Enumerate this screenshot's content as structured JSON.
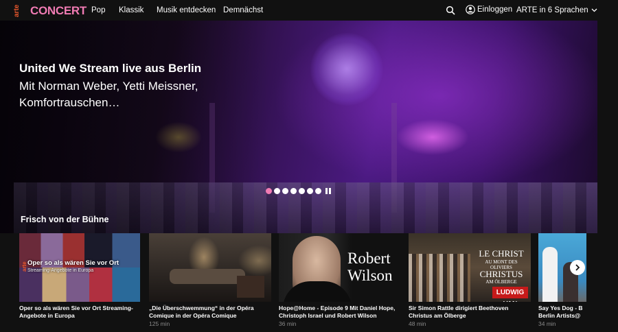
{
  "header": {
    "arte_logo_text": "arte",
    "brand": "CONCERT",
    "nav": [
      "Pop",
      "Klassik",
      "Musik entdecken",
      "Demnächst"
    ],
    "login_label": "Einloggen",
    "language_label": "ARTE in 6 Sprachen",
    "icons": [
      "search-icon",
      "user-icon",
      "chevron-down-icon"
    ]
  },
  "hero": {
    "title": "United We Stream live aus Berlin",
    "subtitle": "Mit Norman Weber, Yetti Meissner, Komfortrauschen…",
    "slide_count": 7,
    "active_slide": 1
  },
  "section": {
    "title": "Frisch von der Bühne",
    "cards": [
      {
        "title": "Oper so als wären Sie vor Ort Streaming-Angebote in Europa",
        "overlay_title": "Oper so als wären Sie vor Ort",
        "overlay_sub": "Streaming-Angebote in Europa",
        "duration": ""
      },
      {
        "title": "„Die Überschwemmung“ in der Opéra Comique in der Opéra Comique",
        "duration": "125 min"
      },
      {
        "title": "Hope@Home - Episode 9 Mit Daniel Hope, Christoph Israel und Robert Wilson",
        "thumb_text": "Robert Wilson",
        "duration": "36 min"
      },
      {
        "title": "Sir Simon Rattle dirigiert Beethoven Christus am Ölberge",
        "thumb_lines": [
          "LE CHRIST",
          "AU MONT DES OLIVIERS",
          "CHRISTUS",
          "AM ÖLBERGE",
          "LUDWIG VAN"
        ],
        "duration": "48 min"
      },
      {
        "title": "Say Yes Dog - B Berlin Artists@",
        "duration": "34 min"
      }
    ]
  },
  "colors": {
    "brand_pink": "#f07bb3",
    "background": "#111111"
  }
}
